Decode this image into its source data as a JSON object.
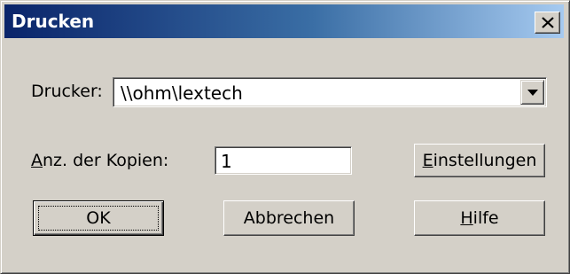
{
  "window": {
    "title": "Drucken"
  },
  "printer": {
    "label": "Drucker:",
    "value": "\\\\ohm\\lextech"
  },
  "copies": {
    "label_mnemonic": "A",
    "label_rest": "nz. der Kopien:",
    "value": "1"
  },
  "buttons": {
    "settings_mnemonic": "E",
    "settings_rest": "instellungen",
    "ok_label": "OK",
    "cancel_label": "Abbrechen",
    "help_mnemonic": "H",
    "help_rest": "ilfe"
  },
  "icons": {
    "close": "close-icon",
    "dropdown": "chevron-down-icon"
  },
  "colors": {
    "title_start": "#0a246a",
    "title_end": "#a6caf0",
    "face": "#d4d0c8"
  }
}
